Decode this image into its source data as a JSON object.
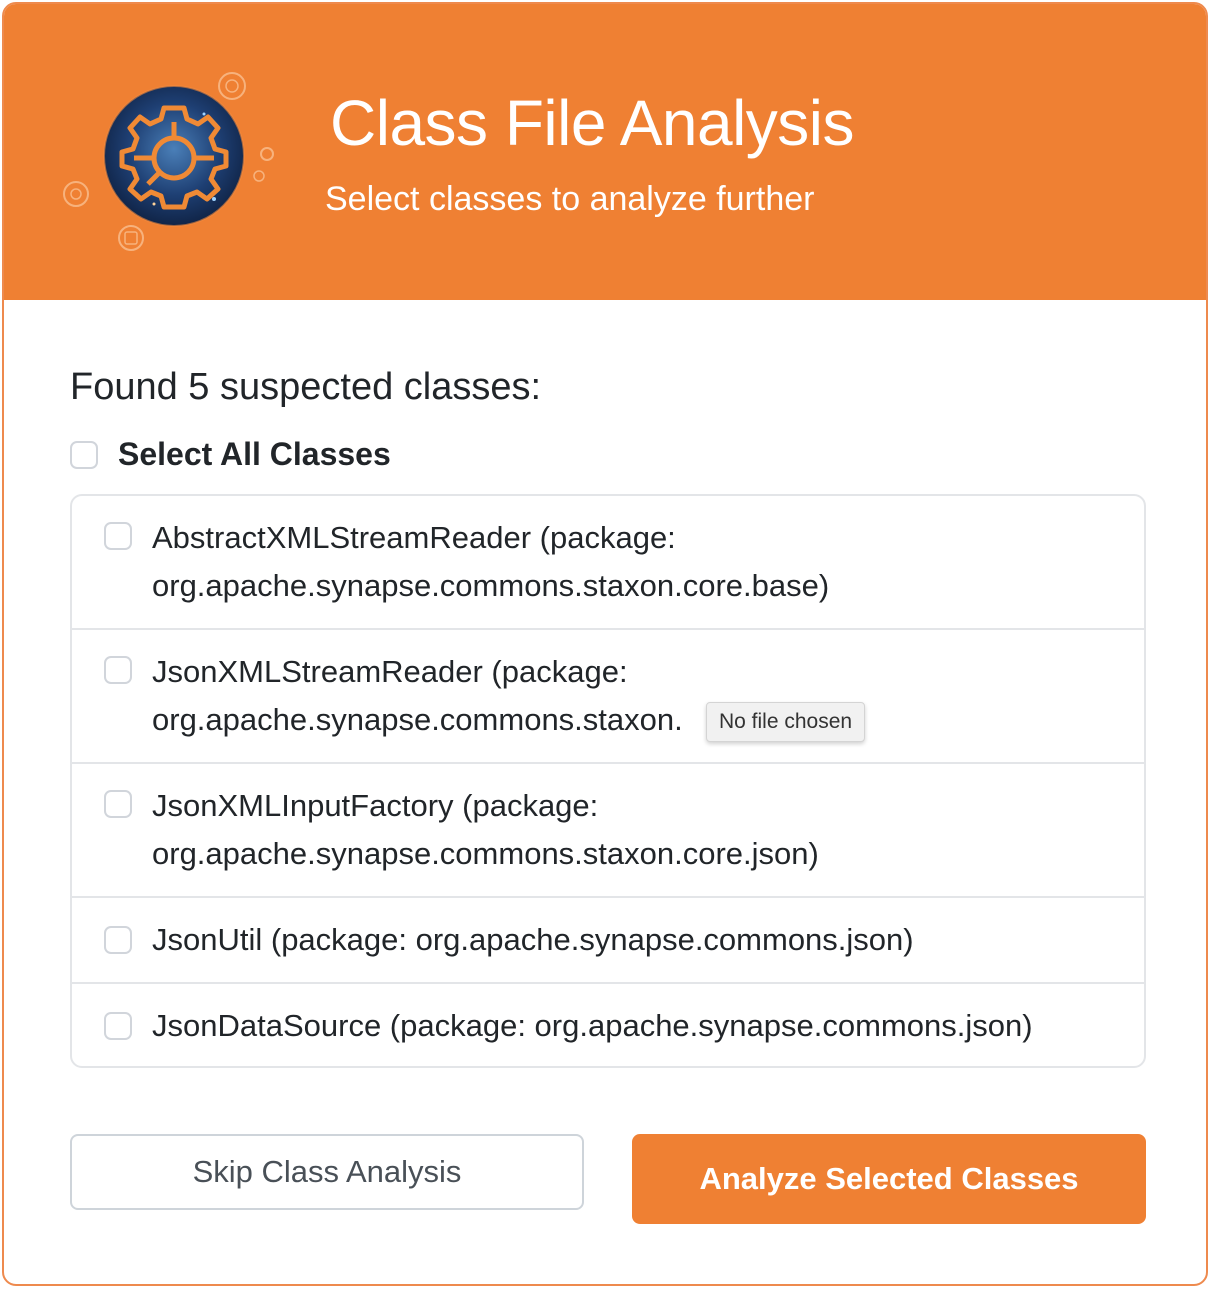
{
  "header": {
    "title": "Class File Analysis",
    "subtitle": "Select classes to analyze further",
    "logo_icon": "gear-circuit-logo-icon"
  },
  "content": {
    "found_text": "Found 5 suspected classes:",
    "select_all_label": "Select All Classes",
    "classes": [
      {
        "name": "AbstractXMLStreamReader (package:",
        "package": "org.apache.synapse.commons.staxon.core.base)"
      },
      {
        "name": "JsonXMLStreamReader (package:",
        "package": "org.apache.synapse.commons.staxon."
      },
      {
        "name": "JsonXMLInputFactory (package:",
        "package": "org.apache.synapse.commons.staxon.core.json)"
      },
      {
        "name": "JsonUtil (package: org.apache.synapse.commons.json)"
      },
      {
        "name": "JsonDataSource (package: org.apache.synapse.commons.json)"
      }
    ],
    "tooltip": "No file chosen"
  },
  "actions": {
    "skip_label": "Skip Class Analysis",
    "analyze_label": "Analyze Selected Classes"
  },
  "colors": {
    "accent": "#ef8033",
    "text": "#212529",
    "border": "#e3e5e8"
  }
}
